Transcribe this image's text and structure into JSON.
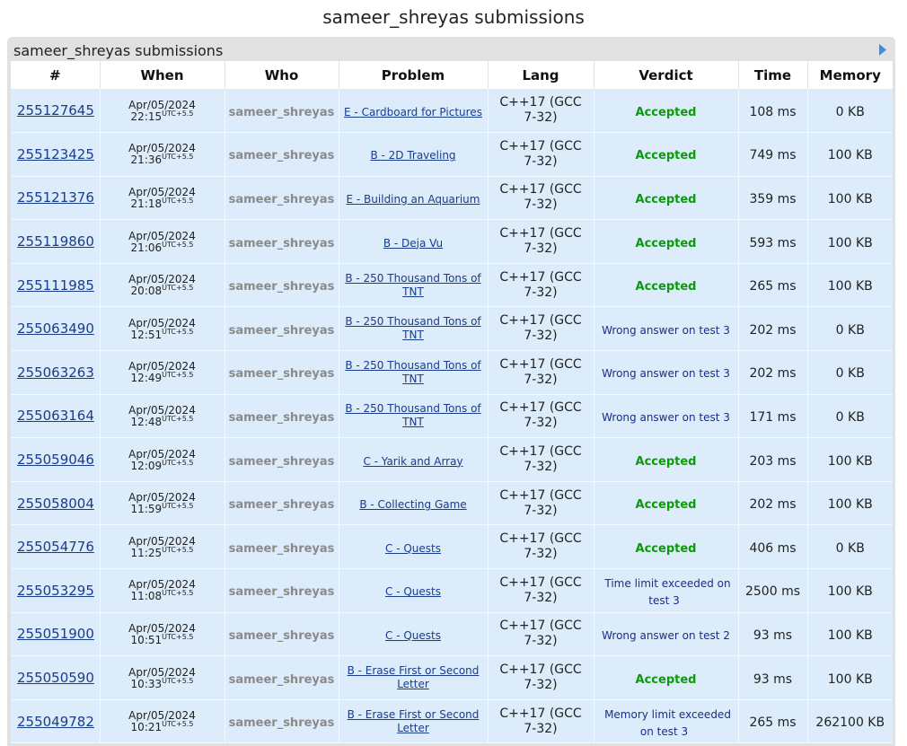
{
  "page": {
    "title": "sameer_shreyas submissions",
    "panel_title": "sameer_shreyas submissions"
  },
  "colors": {
    "accepted": "#0a9a0a",
    "rejected": "#1a2d8a",
    "link": "#1a3c8c",
    "row_bg": "#dcecfa",
    "panel_bg": "#e1e1e1"
  },
  "table": {
    "headers": [
      "#",
      "When",
      "Who",
      "Problem",
      "Lang",
      "Verdict",
      "Time",
      "Memory"
    ],
    "utc_label": "UTC+5.5",
    "rows": [
      {
        "id": "255127645",
        "date": "Apr/05/2024",
        "time": "22:15",
        "who": "sameer_shreyas",
        "problem": "E - Cardboard for Pictures",
        "lang": "C++17 (GCC 7-32)",
        "verdict": "Accepted",
        "accepted": true,
        "runtime": "108 ms",
        "memory": "0 KB"
      },
      {
        "id": "255123425",
        "date": "Apr/05/2024",
        "time": "21:36",
        "who": "sameer_shreyas",
        "problem": "B - 2D Traveling",
        "lang": "C++17 (GCC 7-32)",
        "verdict": "Accepted",
        "accepted": true,
        "runtime": "749 ms",
        "memory": "100 KB"
      },
      {
        "id": "255121376",
        "date": "Apr/05/2024",
        "time": "21:18",
        "who": "sameer_shreyas",
        "problem": "E - Building an Aquarium",
        "lang": "C++17 (GCC 7-32)",
        "verdict": "Accepted",
        "accepted": true,
        "runtime": "359 ms",
        "memory": "100 KB"
      },
      {
        "id": "255119860",
        "date": "Apr/05/2024",
        "time": "21:06",
        "who": "sameer_shreyas",
        "problem": "B - Deja Vu",
        "lang": "C++17 (GCC 7-32)",
        "verdict": "Accepted",
        "accepted": true,
        "runtime": "593 ms",
        "memory": "100 KB"
      },
      {
        "id": "255111985",
        "date": "Apr/05/2024",
        "time": "20:08",
        "who": "sameer_shreyas",
        "problem": "B - 250 Thousand Tons of TNT",
        "lang": "C++17 (GCC 7-32)",
        "verdict": "Accepted",
        "accepted": true,
        "runtime": "265 ms",
        "memory": "100 KB"
      },
      {
        "id": "255063490",
        "date": "Apr/05/2024",
        "time": "12:51",
        "who": "sameer_shreyas",
        "problem": "B - 250 Thousand Tons of TNT",
        "lang": "C++17 (GCC 7-32)",
        "verdict": "Wrong answer on test 3",
        "accepted": false,
        "runtime": "202 ms",
        "memory": "0 KB"
      },
      {
        "id": "255063263",
        "date": "Apr/05/2024",
        "time": "12:49",
        "who": "sameer_shreyas",
        "problem": "B - 250 Thousand Tons of TNT",
        "lang": "C++17 (GCC 7-32)",
        "verdict": "Wrong answer on test 3",
        "accepted": false,
        "runtime": "202 ms",
        "memory": "0 KB"
      },
      {
        "id": "255063164",
        "date": "Apr/05/2024",
        "time": "12:48",
        "who": "sameer_shreyas",
        "problem": "B - 250 Thousand Tons of TNT",
        "lang": "C++17 (GCC 7-32)",
        "verdict": "Wrong answer on test 3",
        "accepted": false,
        "runtime": "171 ms",
        "memory": "0 KB"
      },
      {
        "id": "255059046",
        "date": "Apr/05/2024",
        "time": "12:09",
        "who": "sameer_shreyas",
        "problem": "C - Yarik and Array",
        "lang": "C++17 (GCC 7-32)",
        "verdict": "Accepted",
        "accepted": true,
        "runtime": "203 ms",
        "memory": "100 KB"
      },
      {
        "id": "255058004",
        "date": "Apr/05/2024",
        "time": "11:59",
        "who": "sameer_shreyas",
        "problem": "B - Collecting Game",
        "lang": "C++17 (GCC 7-32)",
        "verdict": "Accepted",
        "accepted": true,
        "runtime": "202 ms",
        "memory": "100 KB"
      },
      {
        "id": "255054776",
        "date": "Apr/05/2024",
        "time": "11:25",
        "who": "sameer_shreyas",
        "problem": "C - Quests",
        "lang": "C++17 (GCC 7-32)",
        "verdict": "Accepted",
        "accepted": true,
        "runtime": "406 ms",
        "memory": "0 KB"
      },
      {
        "id": "255053295",
        "date": "Apr/05/2024",
        "time": "11:08",
        "who": "sameer_shreyas",
        "problem": "C - Quests",
        "lang": "C++17 (GCC 7-32)",
        "verdict": "Time limit exceeded on test 3",
        "accepted": false,
        "runtime": "2500 ms",
        "memory": "100 KB"
      },
      {
        "id": "255051900",
        "date": "Apr/05/2024",
        "time": "10:51",
        "who": "sameer_shreyas",
        "problem": "C - Quests",
        "lang": "C++17 (GCC 7-32)",
        "verdict": "Wrong answer on test 2",
        "accepted": false,
        "runtime": "93 ms",
        "memory": "100 KB"
      },
      {
        "id": "255050590",
        "date": "Apr/05/2024",
        "time": "10:33",
        "who": "sameer_shreyas",
        "problem": "B - Erase First or Second Letter",
        "lang": "C++17 (GCC 7-32)",
        "verdict": "Accepted",
        "accepted": true,
        "runtime": "93 ms",
        "memory": "100 KB"
      },
      {
        "id": "255049782",
        "date": "Apr/05/2024",
        "time": "10:21",
        "who": "sameer_shreyas",
        "problem": "B - Erase First or Second Letter",
        "lang": "C++17 (GCC 7-32)",
        "verdict": "Memory limit exceeded on test 3",
        "accepted": false,
        "runtime": "265 ms",
        "memory": "262100 KB"
      }
    ]
  }
}
